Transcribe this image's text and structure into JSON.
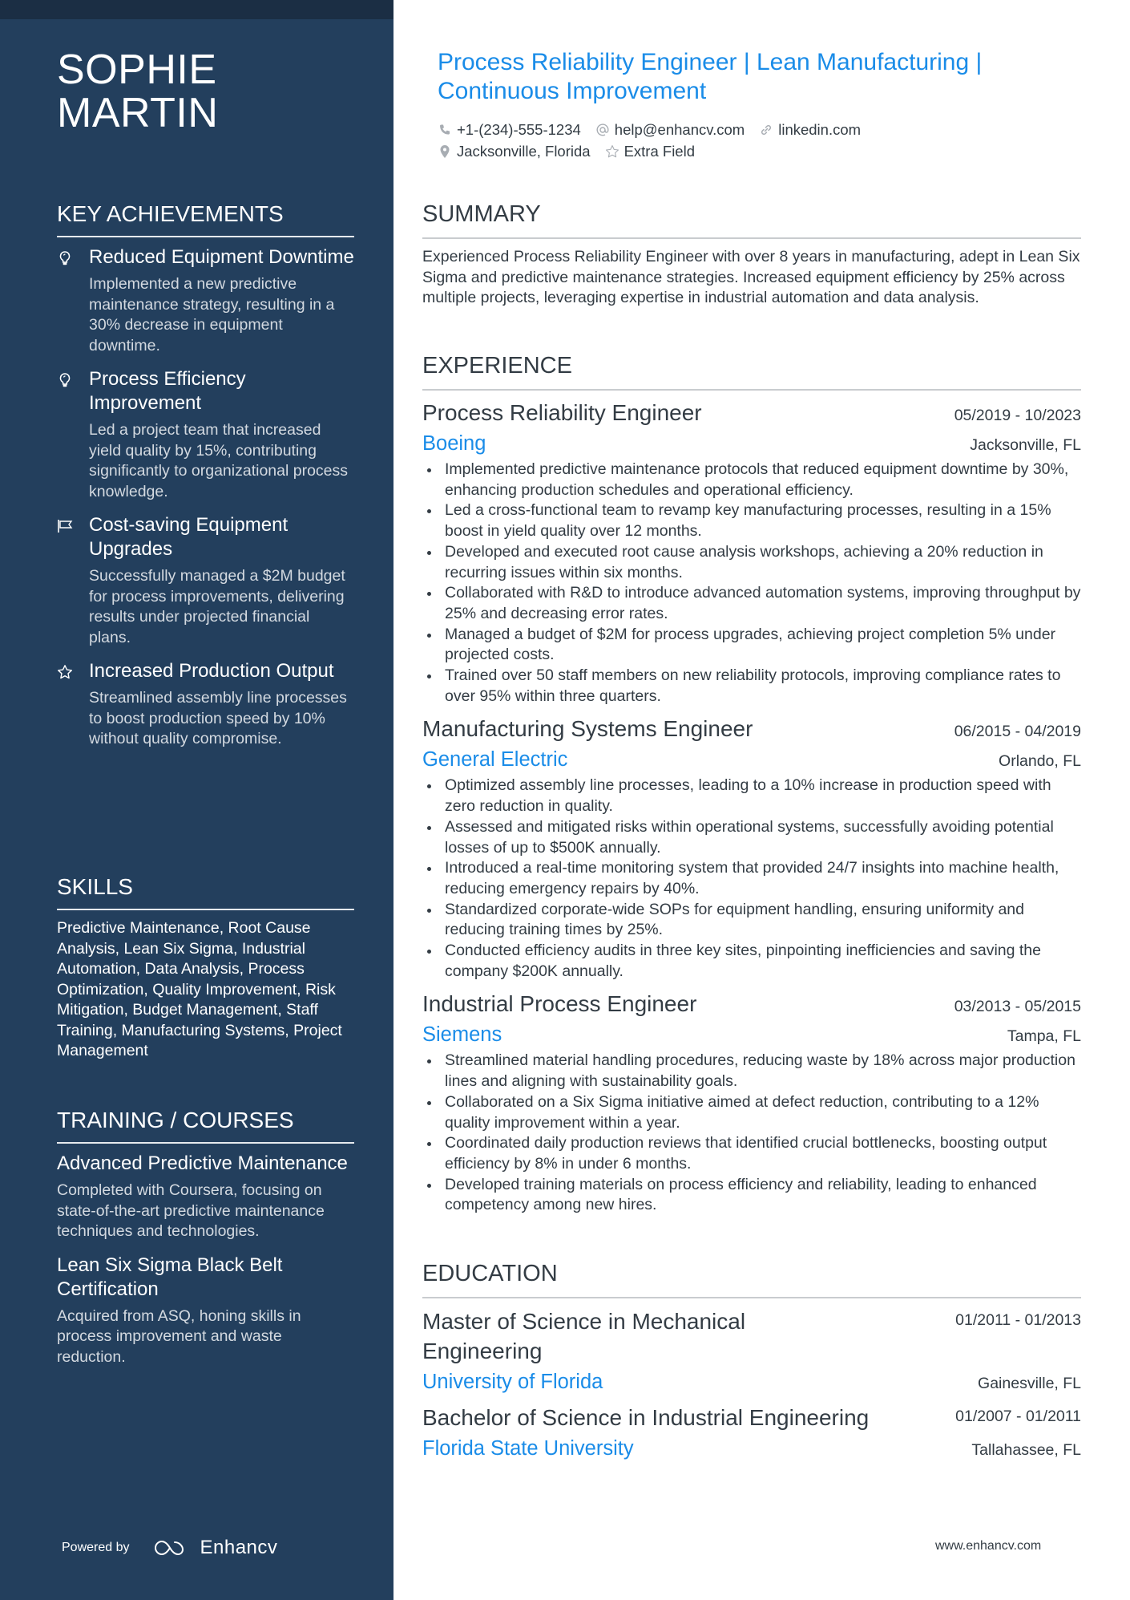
{
  "person": {
    "name_line1": "SOPHIE",
    "name_line2": "MARTIN",
    "headline": "Process Reliability Engineer | Lean Manufacturing | Continuous Improvement"
  },
  "contacts": {
    "phone": "+1-(234)-555-1234",
    "email": "help@enhancv.com",
    "website": "linkedin.com",
    "location": "Jacksonville, Florida",
    "extra": "Extra Field",
    "icons": [
      "phone-icon",
      "at-icon",
      "link-icon",
      "location-pin-icon",
      "star-icon"
    ]
  },
  "sidebar": {
    "achievements_title": "KEY ACHIEVEMENTS",
    "achievements": [
      {
        "icon": "lightbulb-icon",
        "title": "Reduced Equipment Downtime",
        "description": "Implemented a new predictive maintenance strategy, resulting in a 30% decrease in equipment downtime."
      },
      {
        "icon": "lightbulb-icon",
        "title": "Process Efficiency Improvement",
        "description": "Led a project team that increased yield quality by 15%, contributing significantly to organizational process knowledge."
      },
      {
        "icon": "flag-icon",
        "title": "Cost-saving Equipment Upgrades",
        "description": "Successfully managed a $2M budget for process improvements, delivering results under projected financial plans."
      },
      {
        "icon": "star-icon",
        "title": "Increased Production Output",
        "description": "Streamlined assembly line processes to boost production speed by 10% without quality compromise."
      }
    ],
    "skills_title": "SKILLS",
    "skills_text": "Predictive Maintenance, Root Cause Analysis, Lean Six Sigma, Industrial Automation, Data Analysis, Process Optimization, Quality Improvement, Risk Mitigation, Budget Management, Staff Training, Manufacturing Systems, Project Management",
    "training_title": "TRAINING / COURSES",
    "courses": [
      {
        "title": "Advanced Predictive Maintenance",
        "description": "Completed with Coursera, focusing on state-of-the-art predictive maintenance techniques and technologies."
      },
      {
        "title": "Lean Six Sigma Black Belt Certification",
        "description": "Acquired from ASQ, honing skills in process improvement and waste reduction."
      }
    ],
    "powered_by": "Powered by",
    "brand": "Enhancv"
  },
  "summary": {
    "title": "SUMMARY",
    "text": "Experienced Process Reliability Engineer with over 8 years in manufacturing, adept in Lean Six Sigma and predictive maintenance strategies. Increased equipment efficiency by 25% across multiple projects, leveraging expertise in industrial automation and data analysis."
  },
  "experience": {
    "title": "EXPERIENCE",
    "jobs": [
      {
        "title": "Process Reliability Engineer",
        "dates": "05/2019 - 10/2023",
        "company": "Boeing",
        "location": "Jacksonville, FL",
        "bullets": [
          "Implemented predictive maintenance protocols that reduced equipment downtime by 30%, enhancing production schedules and operational efficiency.",
          "Led a cross-functional team to revamp key manufacturing processes, resulting in a 15% boost in yield quality over 12 months.",
          "Developed and executed root cause analysis workshops, achieving a 20% reduction in recurring issues within six months.",
          "Collaborated with R&D to introduce advanced automation systems, improving throughput by 25% and decreasing error rates.",
          "Managed a budget of $2M for process upgrades, achieving project completion 5% under projected costs.",
          "Trained over 50 staff members on new reliability protocols, improving compliance rates to over 95% within three quarters."
        ]
      },
      {
        "title": "Manufacturing Systems Engineer",
        "dates": "06/2015 - 04/2019",
        "company": "General Electric",
        "location": "Orlando, FL",
        "bullets": [
          "Optimized assembly line processes, leading to a 10% increase in production speed with zero reduction in quality.",
          "Assessed and mitigated risks within operational systems, successfully avoiding potential losses of up to $500K annually.",
          "Introduced a real-time monitoring system that provided 24/7 insights into machine health, reducing emergency repairs by 40%.",
          "Standardized corporate-wide SOPs for equipment handling, ensuring uniformity and reducing training times by 25%.",
          "Conducted efficiency audits in three key sites, pinpointing inefficiencies and saving the company $200K annually."
        ]
      },
      {
        "title": "Industrial Process Engineer",
        "dates": "03/2013 - 05/2015",
        "company": "Siemens",
        "location": "Tampa, FL",
        "bullets": [
          "Streamlined material handling procedures, reducing waste by 18% across major production lines and aligning with sustainability goals.",
          "Collaborated on a Six Sigma initiative aimed at defect reduction, contributing to a 12% quality improvement within a year.",
          "Coordinated daily production reviews that identified crucial bottlenecks, boosting output efficiency by 8% in under 6 months.",
          "Developed training materials on process efficiency and reliability, leading to enhanced competency among new hires."
        ]
      }
    ]
  },
  "education": {
    "title": "EDUCATION",
    "items": [
      {
        "degree": "Master of Science in Mechanical Engineering",
        "dates": "01/2011 - 01/2013",
        "school": "University of Florida",
        "location": "Gainesville, FL"
      },
      {
        "degree": "Bachelor of Science in Industrial Engineering",
        "dates": "01/2007 - 01/2011",
        "school": "Florida State University",
        "location": "Tallahassee, FL"
      }
    ]
  },
  "footer": {
    "url": "www.enhancv.com"
  },
  "colors": {
    "sidebar_bg": "#233f5d",
    "accent": "#1a8ce8",
    "text": "#333c44"
  }
}
